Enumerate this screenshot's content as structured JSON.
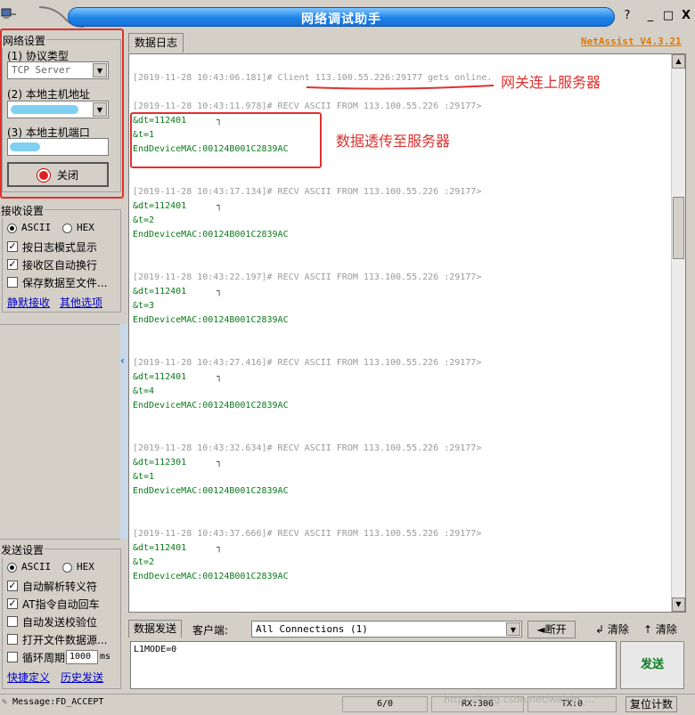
{
  "window": {
    "title": "网络调试助手",
    "help": "?",
    "minimize": "_",
    "maximize": "□",
    "close": "X"
  },
  "network": {
    "group_title": "网络设置",
    "protocol_label": "(1) 协议类型",
    "protocol_value": "TCP Server",
    "host_label": "(2) 本地主机地址",
    "port_label": "(3) 本地主机端口",
    "close_button": "关闭"
  },
  "receive": {
    "group_title": "接收设置",
    "ascii": "ASCII",
    "hex": "HEX",
    "opt_log_mode": "按日志模式显示",
    "opt_auto_wrap": "接收区自动换行",
    "opt_save_file": "保存数据至文件...",
    "link_silent": "静默接收",
    "link_other": "其他选项"
  },
  "send": {
    "group_title": "发送设置",
    "ascii": "ASCII",
    "hex": "HEX",
    "opt_escape": "自动解析转义符",
    "opt_at": "AT指令自动回车",
    "opt_checksum": "自动发送校验位",
    "opt_file_source": "打开文件数据源...",
    "opt_loop": "循环周期",
    "loop_value": "1000",
    "loop_unit": "ms",
    "link_shortcut": "快捷定义",
    "link_history": "历史发送"
  },
  "log": {
    "tab": "数据日志",
    "version": "NetAssist V4.3.21",
    "entries": [
      {
        "head": "[2019-11-28 10:43:06.181]# Client 113.100.55.226:29177 gets online."
      },
      {
        "head": "[2019-11-28 10:43:11.978]# RECV ASCII FROM 113.100.55.226 :29177>",
        "l1": "&dt=112401",
        "l2": "&t=1",
        "l3": "EndDeviceMAC:00124B001C2839AC"
      },
      {
        "head": "[2019-11-28 10:43:17.134]# RECV ASCII FROM 113.100.55.226 :29177>",
        "l1": "&dt=112401",
        "l2": "&t=2",
        "l3": "EndDeviceMAC:00124B001C2839AC"
      },
      {
        "head": "[2019-11-28 10:43:22.197]# RECV ASCII FROM 113.100.55.226 :29177>",
        "l1": "&dt=112401",
        "l2": "&t=3",
        "l3": "EndDeviceMAC:00124B001C2839AC"
      },
      {
        "head": "[2019-11-28 10:43:27.416]# RECV ASCII FROM 113.100.55.226 :29177>",
        "l1": "&dt=112401",
        "l2": "&t=4",
        "l3": "EndDeviceMAC:00124B001C2839AC"
      },
      {
        "head": "[2019-11-28 10:43:32.634]# RECV ASCII FROM 113.100.55.226 :29177>",
        "l1": "&dt=112301",
        "l2": "&t=1",
        "l3": "EndDeviceMAC:00124B001C2839AC"
      },
      {
        "head": "[2019-11-28 10:43:37.666]# RECV ASCII FROM 113.100.55.226 :29177>",
        "l1": "&dt=112401",
        "l2": "&t=2",
        "l3": "EndDeviceMAC:00124B001C2839AC"
      }
    ],
    "tick_mark": "┐"
  },
  "annotations": {
    "gateway": "网关连上服务器",
    "passthrough": "数据透传至服务器"
  },
  "send_area": {
    "tab": "数据发送",
    "client_label": "客户端:",
    "client_value": "All Connections (1)",
    "disconnect": "断开",
    "clear1": "清除",
    "clear2": "清除",
    "content": "L1MODE=0",
    "send_button": "发送"
  },
  "status": {
    "message": "Message:FD_ACCEPT",
    "counter": "6/0",
    "rx": "RX:306",
    "tx": "TX:0",
    "reset": "复位计数"
  },
  "watermark": "https://blog.csdn.net/weixin_..."
}
